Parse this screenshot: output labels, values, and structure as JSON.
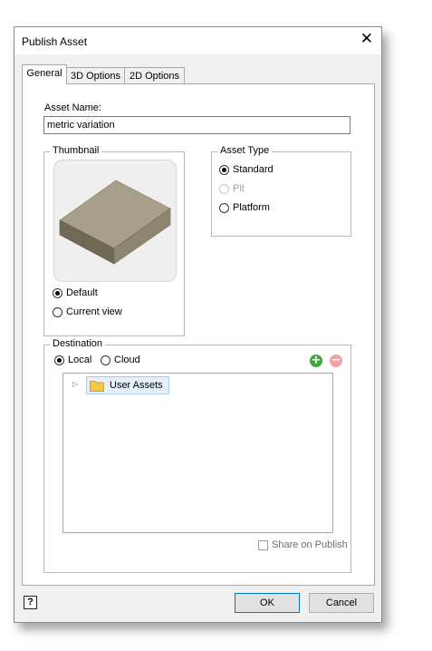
{
  "window": {
    "title": "Publish Asset",
    "close_glyph": "✕"
  },
  "tabs": [
    {
      "label": "General",
      "active": true
    },
    {
      "label": "3D Options",
      "active": false
    },
    {
      "label": "2D Options",
      "active": false
    }
  ],
  "asset_name": {
    "label": "Asset Name:",
    "value": "metric variation"
  },
  "thumbnail": {
    "group_title": "Thumbnail",
    "options": [
      {
        "label": "Default",
        "selected": true
      },
      {
        "label": "Current view",
        "selected": false
      }
    ]
  },
  "asset_type": {
    "group_title": "Asset Type",
    "options": [
      {
        "label": "Standard",
        "selected": true,
        "enabled": true
      },
      {
        "label": "Pit",
        "selected": false,
        "enabled": false
      },
      {
        "label": "Platform",
        "selected": false,
        "enabled": true
      }
    ]
  },
  "destination": {
    "group_title": "Destination",
    "options": [
      {
        "label": "Local",
        "selected": true
      },
      {
        "label": "Cloud",
        "selected": false
      }
    ],
    "tree": [
      {
        "label": "User Assets",
        "icon": "folder-icon"
      }
    ],
    "share_label": "Share on Publish"
  },
  "footer": {
    "help_glyph": "?",
    "ok_label": "OK",
    "cancel_label": "Cancel"
  },
  "colors": {
    "add": "#3ea837",
    "remove": "#f0a1a1",
    "accent": "#0078d7",
    "folder": "#f5c84c"
  },
  "icons": {
    "add": "plus-circle-icon",
    "remove": "minus-circle-icon",
    "help": "help-icon",
    "close": "close-icon",
    "expander": "triangle-right-icon"
  }
}
